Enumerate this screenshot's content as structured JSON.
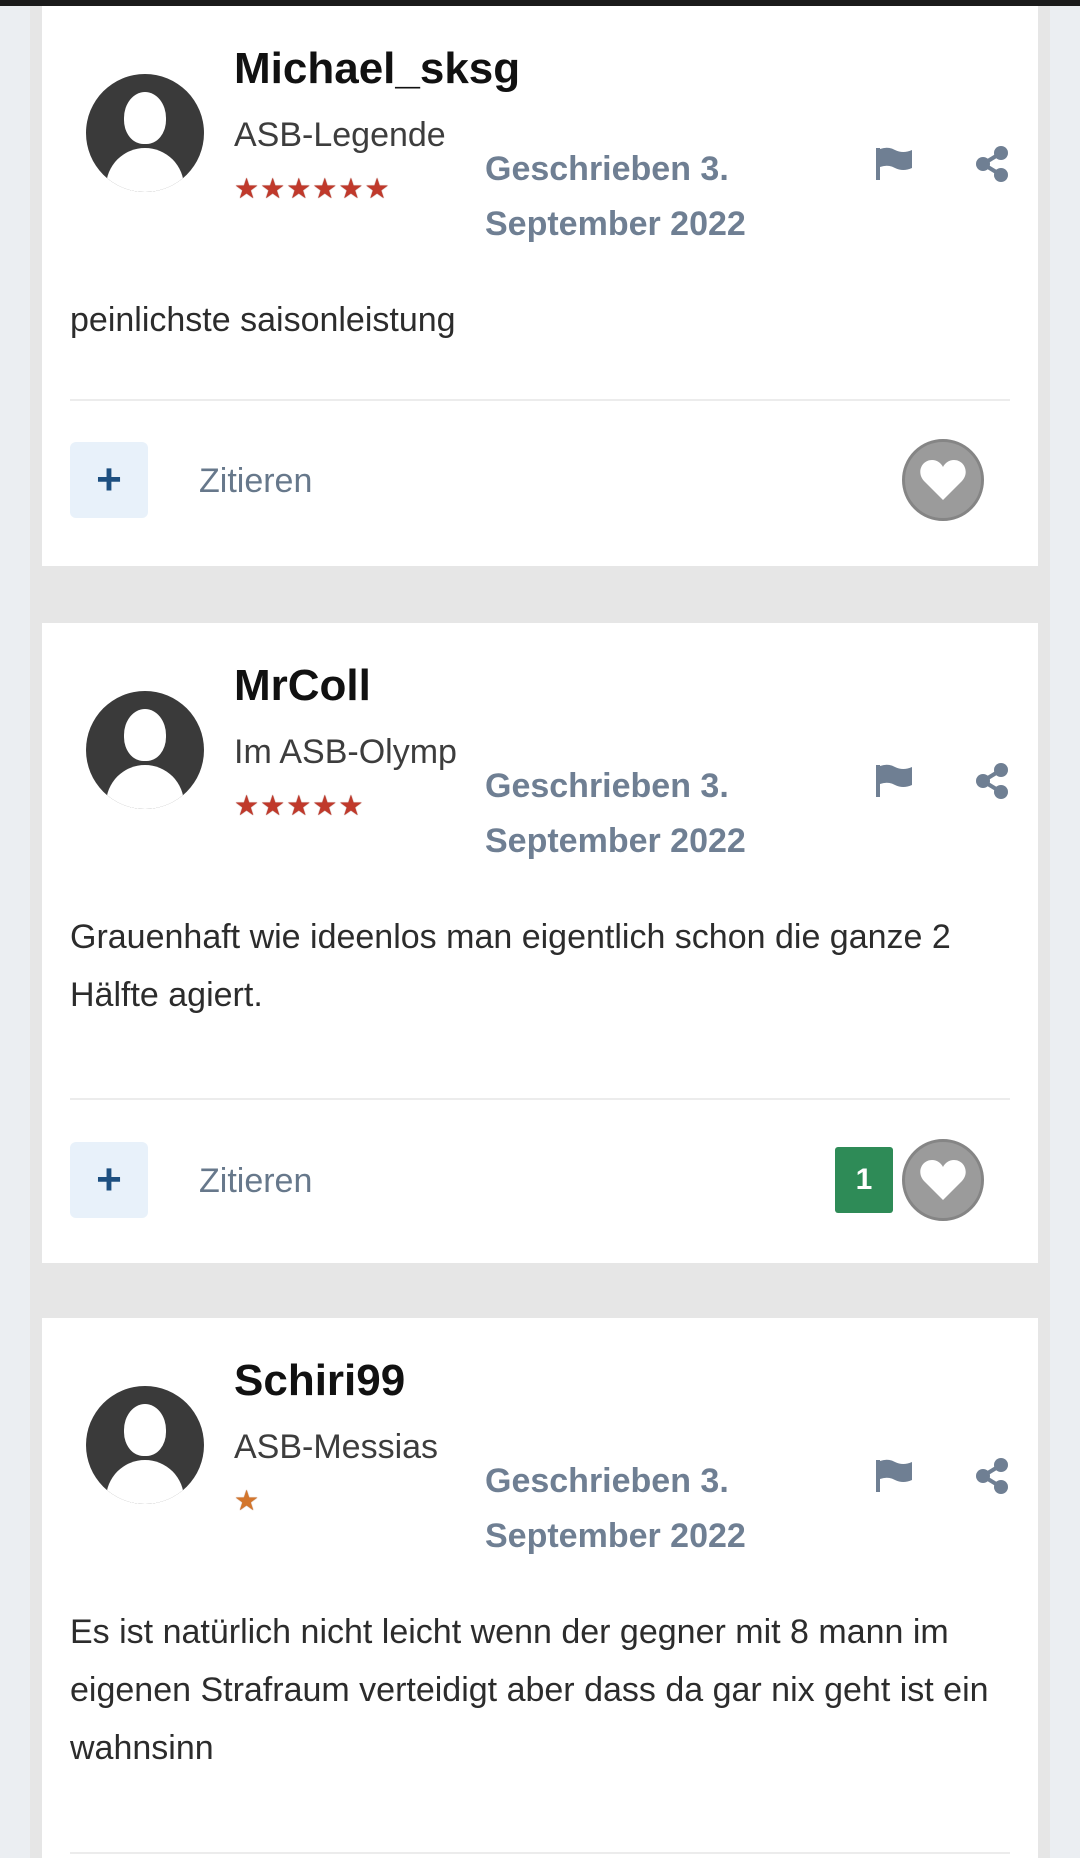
{
  "posts": [
    {
      "username": "Michael_sksg",
      "rank": "ASB-Legende",
      "stars": "★★★★★★",
      "posted": "Geschrieben 3. September 2022",
      "content": "peinlichste saisonleistung",
      "quote_label": "Zitieren",
      "reaction_count": null
    },
    {
      "username": "MrColl",
      "rank": "Im ASB-Olymp",
      "stars": "★★★★★",
      "posted": "Geschrieben 3. September 2022",
      "content": "Grauenhaft wie ideenlos man eigentlich schon die ganze 2 Hälfte agiert.",
      "quote_label": "Zitieren",
      "reaction_count": "1"
    },
    {
      "username": "Schiri99",
      "rank": "ASB-Messias",
      "stars": "★",
      "posted": "Geschrieben 3. September 2022",
      "content": "Es ist natürlich nicht leicht wenn der gegner mit 8 mann im eigenen Strafraum verteidigt aber dass da gar nix geht ist ein wahnsinn",
      "quote_label": "Zitieren",
      "reaction_count": null
    }
  ],
  "icons": {
    "multiquote": "plus-icon",
    "report": "flag-icon",
    "share": "share-icon",
    "like": "heart-icon",
    "avatar": "user-avatar-icon"
  },
  "colors": {
    "accent": "#1d4f80",
    "muted_text": "#6f7f93",
    "reaction_badge": "#2e8b57",
    "stars_red": "#c0392b",
    "stars_orange": "#d4762c"
  }
}
